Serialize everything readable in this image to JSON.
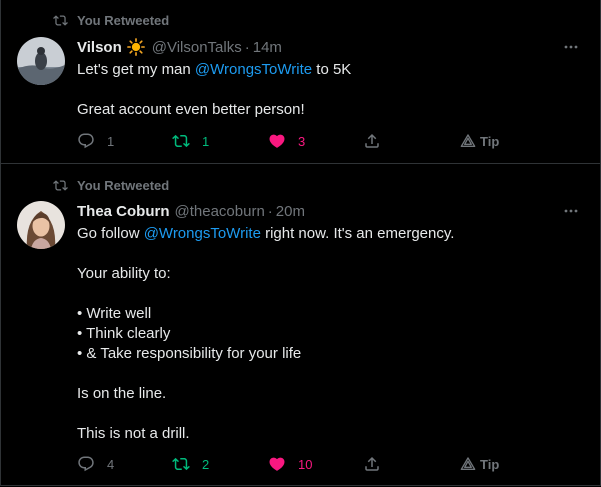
{
  "colors": {
    "background": "#000000",
    "divider": "#2f3336",
    "text": "#e7e9ea",
    "muted": "#71767b",
    "mention": "#1d9bf0",
    "retweet_active": "#00ba7c",
    "like_active": "#f91880"
  },
  "tweets": [
    {
      "retweet_label": "You Retweeted",
      "author_name": "Vilson",
      "author_emoji": "sun-emoji",
      "handle": "@VilsonTalks",
      "separator": "·",
      "time": "14m",
      "lines": [
        {
          "pre": "Let's get my man ",
          "mention": "@WrongsToWrite",
          "post": " to 5K"
        },
        {
          "pre": "",
          "mention": "",
          "post": ""
        },
        {
          "pre": "Great account even better person!",
          "mention": "",
          "post": ""
        }
      ],
      "replies": "1",
      "retweets": "1",
      "likes": "3",
      "tip_label": "Tip"
    },
    {
      "retweet_label": "You Retweeted",
      "author_name": "Thea Coburn",
      "handle": "@theacoburn",
      "separator": "·",
      "time": "20m",
      "lines": [
        {
          "pre": "Go follow ",
          "mention": "@WrongsToWrite",
          "post": " right now. It's an emergency."
        },
        {
          "pre": "",
          "mention": "",
          "post": ""
        },
        {
          "pre": "Your ability to:",
          "mention": "",
          "post": ""
        },
        {
          "pre": "",
          "mention": "",
          "post": ""
        },
        {
          "pre": "• Write well",
          "mention": "",
          "post": ""
        },
        {
          "pre": "• Think clearly",
          "mention": "",
          "post": ""
        },
        {
          "pre": "• & Take responsibility for your life",
          "mention": "",
          "post": ""
        },
        {
          "pre": "",
          "mention": "",
          "post": ""
        },
        {
          "pre": "Is on the line.",
          "mention": "",
          "post": ""
        },
        {
          "pre": "",
          "mention": "",
          "post": ""
        },
        {
          "pre": "This is not a drill.",
          "mention": "",
          "post": ""
        }
      ],
      "replies": "4",
      "retweets": "2",
      "likes": "10",
      "tip_label": "Tip"
    }
  ]
}
